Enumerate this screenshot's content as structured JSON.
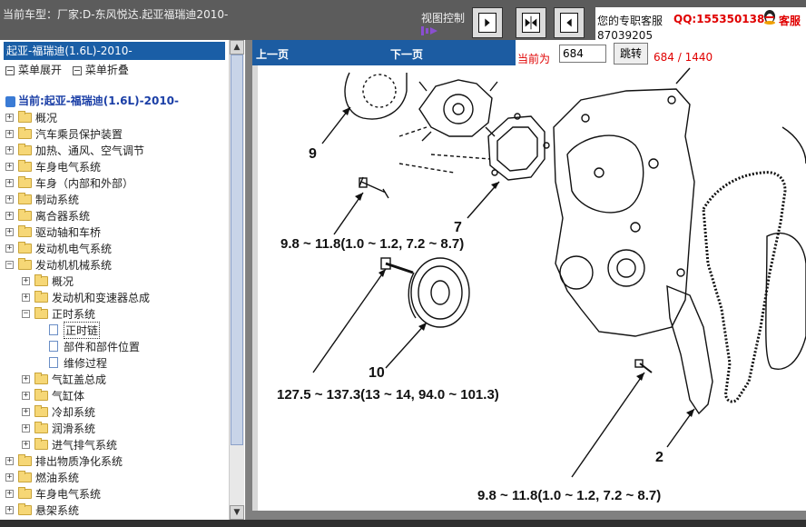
{
  "topbar": {
    "car_title": "当前车型：厂家:D-东风悦达.起亚福瑞迪2010-",
    "view_control_label": "视图控制",
    "support_label": "您的专职客服",
    "qq": "QQ:1553501388",
    "kefu": "客服",
    "phone": "87039205"
  },
  "sidebar": {
    "header": "起亚-福瑞迪(1.6L)-2010-",
    "expand_label": "菜单展开",
    "collapse_label": "菜单折叠",
    "current": "当前:起亚-福瑞迪(1.6L)-2010-",
    "items": [
      {
        "label": "概况",
        "level": 0,
        "state": "+"
      },
      {
        "label": "汽车乘员保护装置",
        "level": 0,
        "state": "+"
      },
      {
        "label": "加热、通风、空气调节",
        "level": 0,
        "state": "+"
      },
      {
        "label": "车身电气系统",
        "level": 0,
        "state": "+"
      },
      {
        "label": "车身（内部和外部）",
        "level": 0,
        "state": "+"
      },
      {
        "label": "制动系统",
        "level": 0,
        "state": "+"
      },
      {
        "label": "离合器系统",
        "level": 0,
        "state": "+"
      },
      {
        "label": "驱动轴和车桥",
        "level": 0,
        "state": "+"
      },
      {
        "label": "发动机电气系统",
        "level": 0,
        "state": "+"
      },
      {
        "label": "发动机机械系统",
        "level": 0,
        "state": "-"
      },
      {
        "label": "概况",
        "level": 1,
        "state": "+"
      },
      {
        "label": "发动机和变速器总成",
        "level": 1,
        "state": "+"
      },
      {
        "label": "正时系统",
        "level": 1,
        "state": "-"
      },
      {
        "label": "正时链",
        "level": 2,
        "state": "doc"
      },
      {
        "label": "部件和部件位置",
        "level": 2,
        "state": "doc"
      },
      {
        "label": "维修过程",
        "level": 2,
        "state": "doc"
      },
      {
        "label": "气缸盖总成",
        "level": 1,
        "state": "+"
      },
      {
        "label": "气缸体",
        "level": 1,
        "state": "+"
      },
      {
        "label": "冷却系统",
        "level": 1,
        "state": "+"
      },
      {
        "label": "润滑系统",
        "level": 1,
        "state": "+"
      },
      {
        "label": "进气排气系统",
        "level": 1,
        "state": "+"
      },
      {
        "label": "排出物质净化系统",
        "level": 0,
        "state": "+"
      },
      {
        "label": "燃油系统",
        "level": 0,
        "state": "+"
      },
      {
        "label": "车身电气系统",
        "level": 0,
        "state": "+"
      },
      {
        "label": "悬架系统",
        "level": 0,
        "state": "+"
      }
    ]
  },
  "nav": {
    "prev": "上一页",
    "next": "下一页",
    "current_page_label": "当前为",
    "page_value": "684",
    "go_button": "跳转",
    "page_count": "684 / 1440"
  },
  "diagram": {
    "labels": {
      "l9": "9",
      "l7": "7",
      "l10": "10",
      "l2": "2",
      "t1": "9.8 ~ 11.8(1.0 ~ 1.2, 7.2 ~ 8.7)",
      "t2": "127.5 ~ 137.3(13 ~ 14, 94.0 ~ 101.3)",
      "t3": "9.8 ~ 11.8(1.0 ~ 1.2, 7.2 ~ 8.7)"
    }
  }
}
